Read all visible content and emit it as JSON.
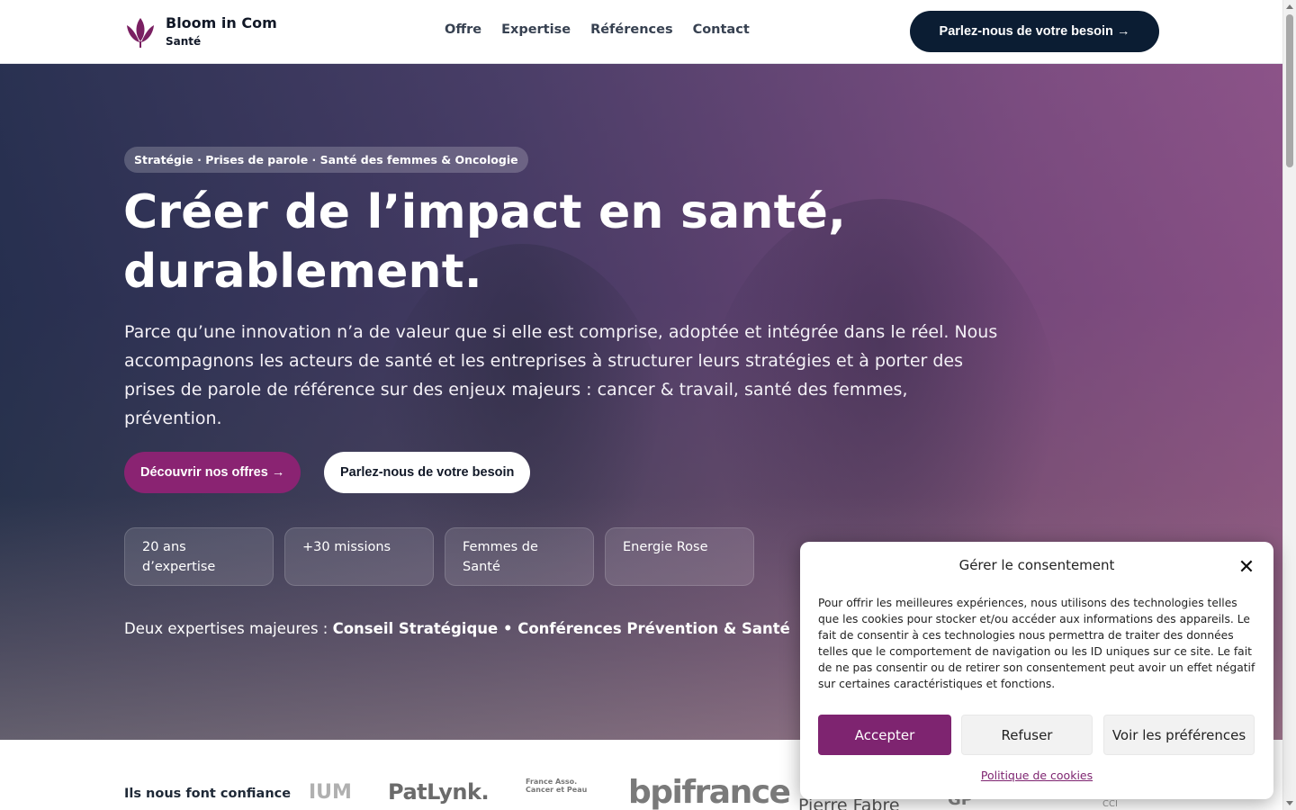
{
  "header": {
    "brand": "Bloom in Com",
    "brand_sub": "Santé",
    "nav": [
      "Offre",
      "Expertise",
      "Références",
      "Contact"
    ],
    "cta": "Parlez-nous de votre besoin →"
  },
  "hero": {
    "tagline": "Stratégie · Prises de parole · Santé des femmes & Oncologie",
    "title_line1": "Créer de l’impact en santé,",
    "title_line2": "durablement.",
    "description": "Parce qu’une innovation n’a de valeur que si elle est comprise, adoptée et intégrée dans le réel. Nous accompagnons les acteurs de santé et les entreprises à structurer leurs stratégies et à porter des prises de parole de référence sur des enjeux majeurs : cancer & travail, santé des femmes, prévention.",
    "primary_button": "Découvrir nos offres →",
    "secondary_button": "Parlez-nous de votre besoin",
    "stats": [
      "20 ans d’expertise",
      "+30 missions",
      "Femmes de Santé",
      "Energie Rose"
    ],
    "expertises_prefix": "Deux expertises majeures :",
    "expertises_bold": "Conseil Stratégique • Conférences Prévention & Santé"
  },
  "trust": {
    "label": "Ils nous font confiance",
    "logos": [
      "IUM",
      "PatLynk.",
      "France Asso. Cancer et Peau",
      "bpifrance",
      "Pierre Fabre",
      "GP",
      "CCI"
    ]
  },
  "consent": {
    "title": "Gérer le consentement",
    "text": "Pour offrir les meilleures expériences, nous utilisons des technologies telles que les cookies pour stocker et/ou accéder aux informations des appareils. Le fait de consentir à ces technologies nous permettra de traiter des données telles que le comportement de navigation ou les ID uniques sur ce site. Le fait de ne pas consentir ou de retirer son consentement peut avoir un effet négatif sur certaines caractéristiques et fonctions.",
    "accept": "Accepter",
    "refuse": "Refuser",
    "preferences": "Voir les préférences",
    "policy": "Politique de cookies"
  },
  "colors": {
    "brand_purple": "#8a2372",
    "navy": "#0b1d33"
  }
}
